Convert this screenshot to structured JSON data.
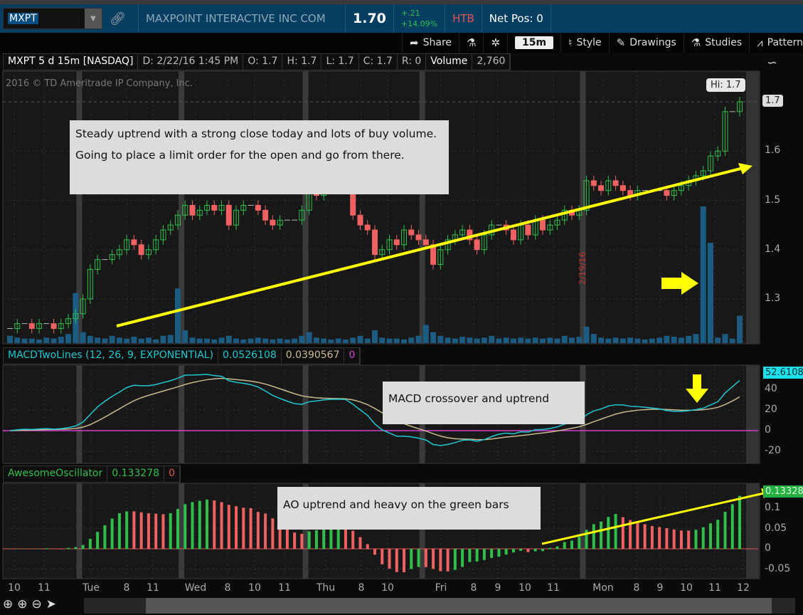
{
  "header": {
    "symbol": "MXPT",
    "company": "MAXPOINT INTERACTIVE INC COM",
    "last": "1.70",
    "change": "+.21",
    "change_pct": "+14.09%",
    "htb": "HTB",
    "net_pos": "Net Pos: 0"
  },
  "toolbar": {
    "share": "Share",
    "timeframe": "15m",
    "style": "Style",
    "drawings": "Drawings",
    "studies": "Studies",
    "patterns": "Pattern"
  },
  "infobar": {
    "title": "MXPT 5 d 15m [NASDAQ]",
    "date": "D: 2/22/16 1:45 PM",
    "open": "O: 1.7",
    "high": "H: 1.7",
    "low": "L: 1.7",
    "close": "C: 1.7",
    "range": "R: 0",
    "volume_label": "Volume",
    "volume": "2,760"
  },
  "copyright": "2016 © TD Ameritrade IP Company, Inc.",
  "hi_label": "Hi: 1.7",
  "price_axis": {
    "last": "1.7",
    "ticks": [
      "1.6",
      "1.5",
      "1.4",
      "1.3"
    ]
  },
  "macd": {
    "title": "MACDTwoLines (12, 26, 9, EXPONENTIAL)",
    "value": "0.0526108",
    "avg": "0.0390567",
    "zero": "0",
    "axis_last": "52.6108",
    "ticks": [
      "40",
      "20",
      "0",
      "-20"
    ]
  },
  "ao": {
    "title": "AwesomeOscillator",
    "value": "0.133278",
    "zero": "0",
    "axis_last": "0.13328",
    "ticks": [
      "0.1",
      "0.05",
      "0",
      "-0.05"
    ]
  },
  "date_marker": "2/19/16",
  "notes": {
    "price": "Steady uptrend with a strong close today and lots of buy volume. Going to place a limit order for the open and go from there.",
    "macd": "MACD crossover and uptrend",
    "ao": "AO uptrend and heavy on the green bars"
  },
  "time_axis": [
    "10",
    "11",
    "Tue",
    "8",
    "11",
    "Wed",
    "8",
    "10",
    "11",
    "Thu",
    "8",
    "10",
    "Fri",
    "8",
    "9",
    "10",
    "11",
    "Mon",
    "8",
    "9",
    "10",
    "11",
    "12"
  ],
  "colors": {
    "up": "#2fbf4a",
    "down": "#f06262",
    "volume": "#1c5b82",
    "macd": "#1ec8d2",
    "signal": "#c8b98e",
    "zero": "#d040d0",
    "annot": "#ffff00"
  },
  "chart_data": {
    "type": "candlestick",
    "closes": [
      1.24,
      1.25,
      1.25,
      1.24,
      1.25,
      1.25,
      1.24,
      1.25,
      1.26,
      1.27,
      1.3,
      1.36,
      1.38,
      1.38,
      1.39,
      1.4,
      1.42,
      1.41,
      1.39,
      1.4,
      1.42,
      1.44,
      1.45,
      1.47,
      1.49,
      1.47,
      1.48,
      1.49,
      1.48,
      1.49,
      1.45,
      1.48,
      1.49,
      1.49,
      1.48,
      1.46,
      1.45,
      1.46,
      1.46,
      1.46,
      1.48,
      1.52,
      1.51,
      1.52,
      1.52,
      1.52,
      1.52,
      1.47,
      1.45,
      1.44,
      1.39,
      1.4,
      1.42,
      1.41,
      1.44,
      1.43,
      1.42,
      1.41,
      1.37,
      1.4,
      1.42,
      1.43,
      1.44,
      1.42,
      1.4,
      1.43,
      1.45,
      1.45,
      1.44,
      1.42,
      1.45,
      1.43,
      1.46,
      1.44,
      1.45,
      1.46,
      1.48,
      1.47,
      1.48,
      1.54,
      1.53,
      1.52,
      1.54,
      1.53,
      1.52,
      1.51,
      1.52,
      1.52,
      1.52,
      1.52,
      1.51,
      1.52,
      1.53,
      1.54,
      1.55,
      1.56,
      1.59,
      1.6,
      1.68,
      1.68,
      1.7
    ],
    "volumes": [
      8,
      6,
      5,
      5,
      4,
      6,
      5,
      7,
      10,
      55,
      12,
      8,
      6,
      5,
      8,
      6,
      5,
      7,
      5,
      6,
      4,
      8,
      9,
      60,
      14,
      6,
      5,
      5,
      4,
      6,
      8,
      5,
      4,
      5,
      6,
      5,
      4,
      5,
      4,
      5,
      8,
      12,
      6,
      5,
      4,
      5,
      4,
      6,
      8,
      5,
      14,
      6,
      5,
      5,
      4,
      6,
      8,
      20,
      12,
      8,
      6,
      5,
      7,
      6,
      5,
      6,
      8,
      5,
      6,
      5,
      6,
      5,
      6,
      5,
      6,
      5,
      8,
      6,
      7,
      18,
      10,
      6,
      5,
      6,
      5,
      6,
      5,
      4,
      5,
      6,
      8,
      7,
      6,
      8,
      10,
      150,
      110,
      6,
      10,
      5,
      30
    ],
    "session_breaks_after": [
      9,
      23,
      40,
      56,
      78
    ],
    "price_range": [
      1.2,
      1.75
    ]
  }
}
